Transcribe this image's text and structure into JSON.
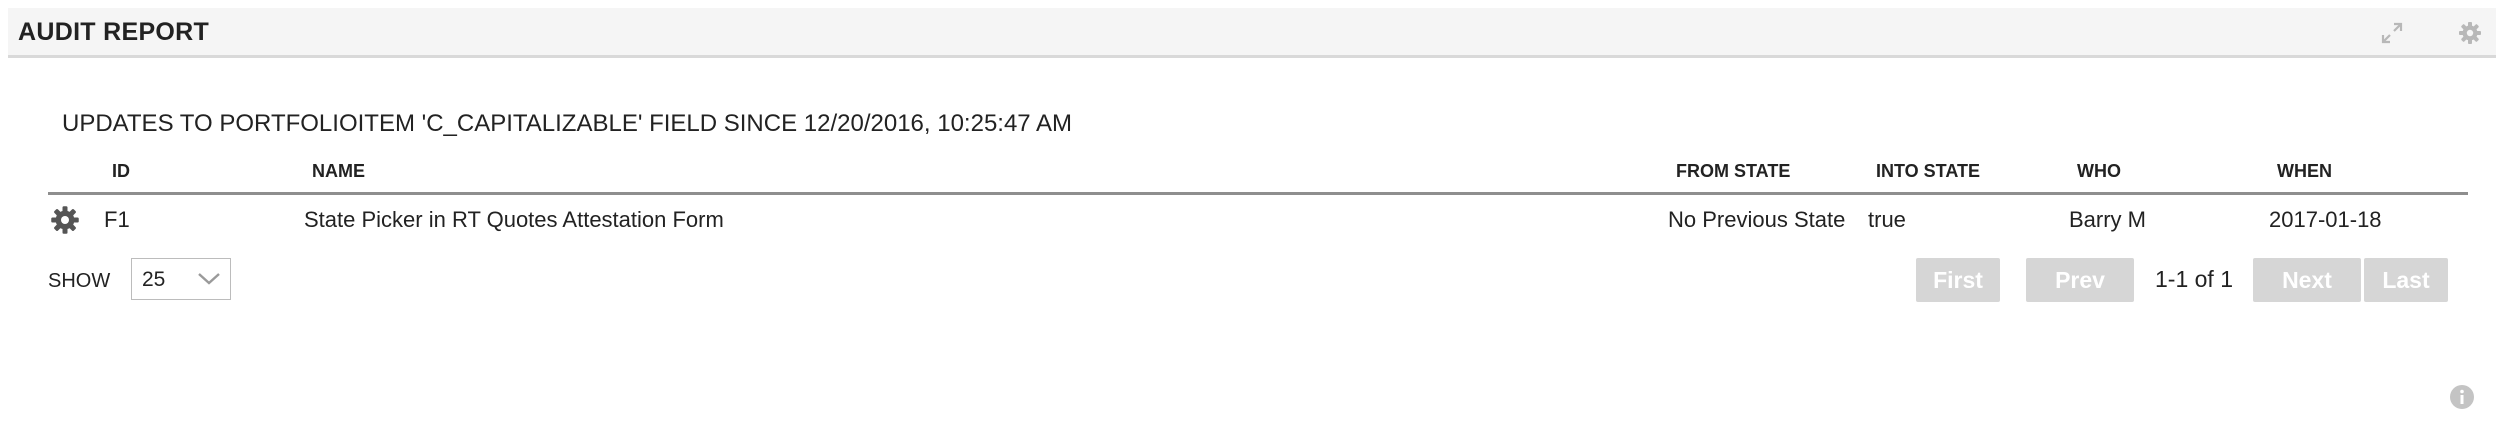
{
  "header": {
    "title": "AUDIT REPORT",
    "expand_icon": "expand-icon",
    "settings_icon": "gear-icon"
  },
  "report": {
    "title": "UPDATES TO PORTFOLIOITEM 'C_CAPITALIZABLE' FIELD SINCE 12/20/2016, 10:25:47 AM"
  },
  "table": {
    "columns": {
      "id": "ID",
      "name": "NAME",
      "from_state": "FROM STATE",
      "into_state": "INTO STATE",
      "who": "WHO",
      "when": "WHEN"
    },
    "rows": [
      {
        "id": "F1",
        "name": "State Picker in RT Quotes Attestation Form",
        "from_state": "No Previous State",
        "into_state": "true",
        "who": "Barry M",
        "when": "2017-01-18"
      }
    ]
  },
  "pagination": {
    "show_label": "SHOW",
    "page_size": "25",
    "first_label": "First",
    "prev_label": "Prev",
    "page_info": "1-1 of 1",
    "next_label": "Next",
    "last_label": "Last"
  },
  "colors": {
    "header_bg": "#f5f5f5",
    "disabled_button_bg": "#d6d6d6",
    "table_rule": "#8e8e8e",
    "icon_gray": "#b8b8b8",
    "row_gear": "#555555"
  }
}
